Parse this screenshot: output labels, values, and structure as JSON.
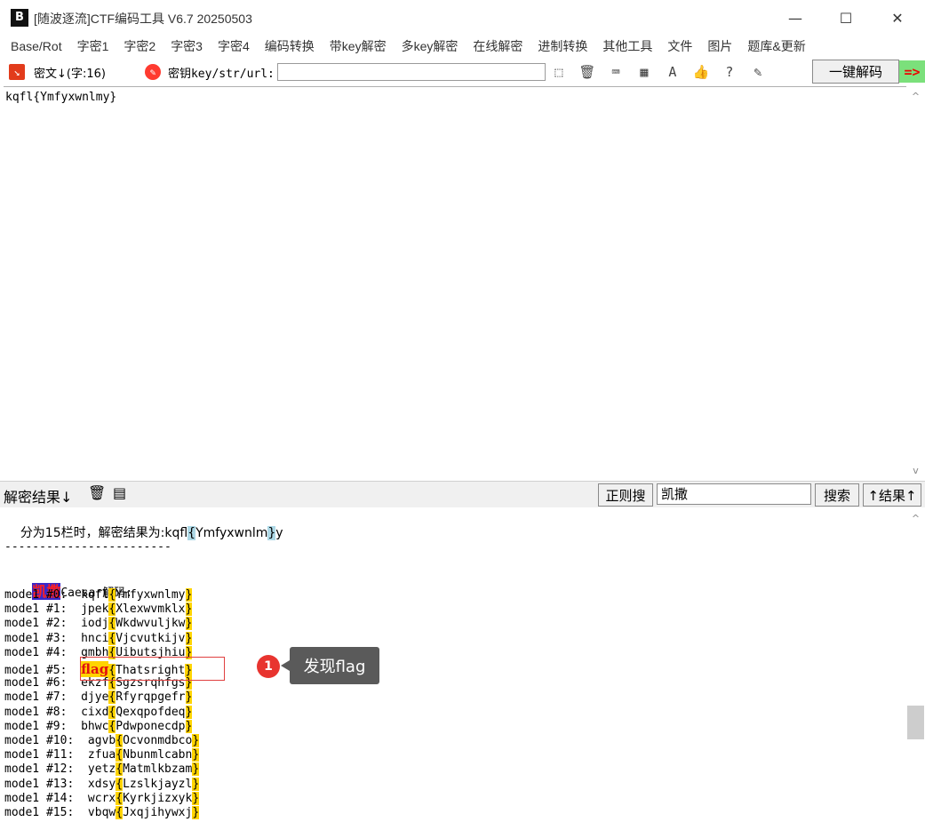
{
  "window": {
    "title": "[随波逐流]CTF编码工具 V6.7  20250503",
    "logo": "B",
    "minimize": "—",
    "maximize": "☐",
    "close": "✕"
  },
  "menu": {
    "items": [
      "Base/Rot",
      "字密1",
      "字密2",
      "字密3",
      "字密4",
      "编码转换",
      "带key解密",
      "多key解密",
      "在线解密",
      "进制转换",
      "其他工具",
      "文件",
      "图片",
      "题库&更新"
    ]
  },
  "toolbar": {
    "cipher_label": "密文↓(字:16)",
    "key_label": "密钥key/str/url:",
    "key_value": "",
    "decode_button": "一键解码",
    "arrow": "=>",
    "icons": [
      "cursor-icon",
      "trash-icon",
      "terminal-icon",
      "table-icon",
      "font-icon",
      "thumbs-up-icon",
      "help-icon",
      "edit-icon"
    ]
  },
  "cipher": {
    "text": "kqfl{Ymfyxwnlmy}"
  },
  "result_bar": {
    "label": "解密结果↓",
    "regex_button": "正则搜",
    "search_value": "凯撒",
    "search_button": "搜索",
    "result_up_button": "↑结果↑"
  },
  "output": {
    "partial_line": "分为15栏时，解密结果为:kqfl",
    "partial_brace_open": "{",
    "partial_mid": "Ymfyxwnlm",
    "partial_brace_close": "}",
    "partial_tail": "y",
    "divider": "------------------------",
    "caesar_tag": "凯撒",
    "caesar_header": "Caesar解码:",
    "modes": [
      {
        "label": "mode1 #0:  ",
        "prefix": "kqfl",
        "inner": "Ymfyxwnlmy"
      },
      {
        "label": "mode1 #1:  ",
        "prefix": "jpek",
        "inner": "Xlexwvmklx"
      },
      {
        "label": "mode1 #2:  ",
        "prefix": "iodj",
        "inner": "Wkdwvuljkw"
      },
      {
        "label": "mode1 #3:  ",
        "prefix": "hnci",
        "inner": "Vjcvutkijv"
      },
      {
        "label": "mode1 #4:  ",
        "prefix": "gmbh",
        "inner": "Uibutsjhiu"
      },
      {
        "label": "mode1 #5:  ",
        "prefix": "flag",
        "inner": "Thatsright"
      },
      {
        "label": "mode1 #6:  ",
        "prefix": "ekzf",
        "inner": "Sgzsrqhfgs"
      },
      {
        "label": "mode1 #7:  ",
        "prefix": "djye",
        "inner": "Rfyrqpgefr"
      },
      {
        "label": "mode1 #8:  ",
        "prefix": "cixd",
        "inner": "Qexqpofdeq"
      },
      {
        "label": "mode1 #9:  ",
        "prefix": "bhwc",
        "inner": "Pdwponecdp"
      },
      {
        "label": "mode1 #10:  ",
        "prefix": "agvb",
        "inner": "Ocvonmdbco"
      },
      {
        "label": "mode1 #11:  ",
        "prefix": "zfua",
        "inner": "Nbunmlcabn"
      },
      {
        "label": "mode1 #12:  ",
        "prefix": "yetz",
        "inner": "Matmlkbzam"
      },
      {
        "label": "mode1 #13:  ",
        "prefix": "xdsy",
        "inner": "Lzslkjayzl"
      },
      {
        "label": "mode1 #14:  ",
        "prefix": "wcrx",
        "inner": "Kyrkjizxyk"
      },
      {
        "label": "mode1 #15:  ",
        "prefix": "vbqw",
        "inner": "Jxqjihywxj"
      }
    ]
  },
  "annotation": {
    "number": "1",
    "text": "发现flag"
  }
}
